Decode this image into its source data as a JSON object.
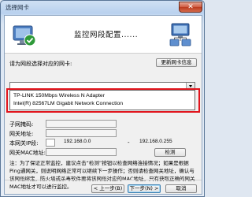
{
  "window": {
    "title": "选择网卡",
    "close_glyph": "✕"
  },
  "banner": {
    "title": "监控网段配置......",
    "left_icon": "network-adapter-check-icon",
    "right_icon": "network-computers-icon"
  },
  "adapter": {
    "prompt_label": "请为网段选择对应的网卡:",
    "refresh_button": "更新网卡信息",
    "selected_value": "",
    "options": [
      "TP-LINK 150Mbps Wireless N Adapter",
      "Intel(R) 82567LM Gigabit Network Connection"
    ],
    "highlight_color": "#e1141c"
  },
  "form": {
    "subnet_mask_label": "子网掩码:",
    "gateway_label": "网关地址:",
    "ip_range_label": "本网关IP段:",
    "ip_start": "192.168.0.0",
    "ip_separator": "-",
    "ip_end": "192.168.0.255",
    "gateway_mac_label": "网关MAC地址:",
    "detect_button": "检测"
  },
  "note": {
    "text": "注：为了保证正常监控，建议点击“检测”按钮以检查网络连接情况；如果是根据Ping通网关，则说明网络正常可以继续下一步操作；否则请检查网关地址，确认与该网段绑定，防火墙或杀毒软件要将该网段对应的MAC地址，只有获取正确的网关MAC地址才可以进行监控。"
  },
  "footer": {
    "back_button": "< 上一步(B)",
    "next_button": "下一步(N) >",
    "cancel_button": "取消"
  }
}
